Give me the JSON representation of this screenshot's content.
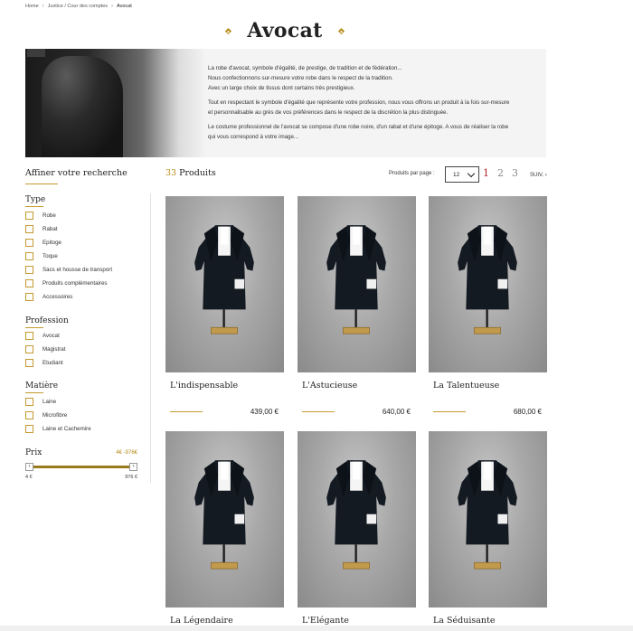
{
  "breadcrumb": [
    {
      "label": "Home"
    },
    {
      "label": "Justice / Cour des comptes"
    },
    {
      "label": "Avocat"
    }
  ],
  "page_title": "Avocat",
  "banner": {
    "paragraphs": [
      [
        "La robe d'avocat, symbole d'égalité, de prestige, de tradition et de fédération...",
        "Nous confectionnons sur-mesure votre robe dans le respect de la tradition.",
        "Avec un large choix de tissus dont certains très prestigieux."
      ],
      [
        "Tout en respectant le symbole d'égalité que représente votre profession, nous vous offrons un produit à la fois sur-mesure",
        "et personnalisable au grès de vos préférences dans le respect de la discrétion la plus distinguée."
      ],
      [
        "Le costume professionnel de l'avocat se compose d'une robe noire, d'un rabat et d'une épitoge. A vous de réaliser la robe",
        "qui vous correspond à votre image..."
      ]
    ]
  },
  "filters": {
    "title": "Affiner votre recherche",
    "groups": [
      {
        "title": "Type",
        "options": [
          "Robe",
          "Rabat",
          "Epitoge",
          "Toque",
          "Sacs et housse de transport",
          "Produits complémentaires",
          "Accessoires"
        ]
      },
      {
        "title": "Profession",
        "options": [
          "Avocat",
          "Magistrat",
          "Etudiant"
        ]
      },
      {
        "title": "Matière",
        "options": [
          "Laine",
          "Microfibre",
          "Laine et Cachemire"
        ]
      }
    ],
    "price": {
      "label": "Prix",
      "range_text": "4€ -976€",
      "min_label": "4 €",
      "max_label": "976 €",
      "handle_left": "‹",
      "handle_right": "›",
      "selected_min_fraction": 0,
      "selected_max_fraction": 1
    }
  },
  "results": {
    "count": "33",
    "count_label": "Produits",
    "per_page_label": "Produits par page :",
    "per_page_value": "12",
    "pages": [
      "1",
      "2",
      "3"
    ],
    "current_page": "1",
    "next_label": "SUIV. ›"
  },
  "products": [
    {
      "name": "L'indispensable",
      "price": "439,00 €"
    },
    {
      "name": "L'Astucieuse",
      "price": "640,00 €"
    },
    {
      "name": "La Talentueuse",
      "price": "680,00 €"
    },
    {
      "name": "La Légendaire",
      "price": ""
    },
    {
      "name": "L'Elégante",
      "price": ""
    },
    {
      "name": "La Séduisante",
      "price": ""
    }
  ],
  "colors": {
    "accent": "#c59a2e",
    "active_page": "#b0222b"
  }
}
